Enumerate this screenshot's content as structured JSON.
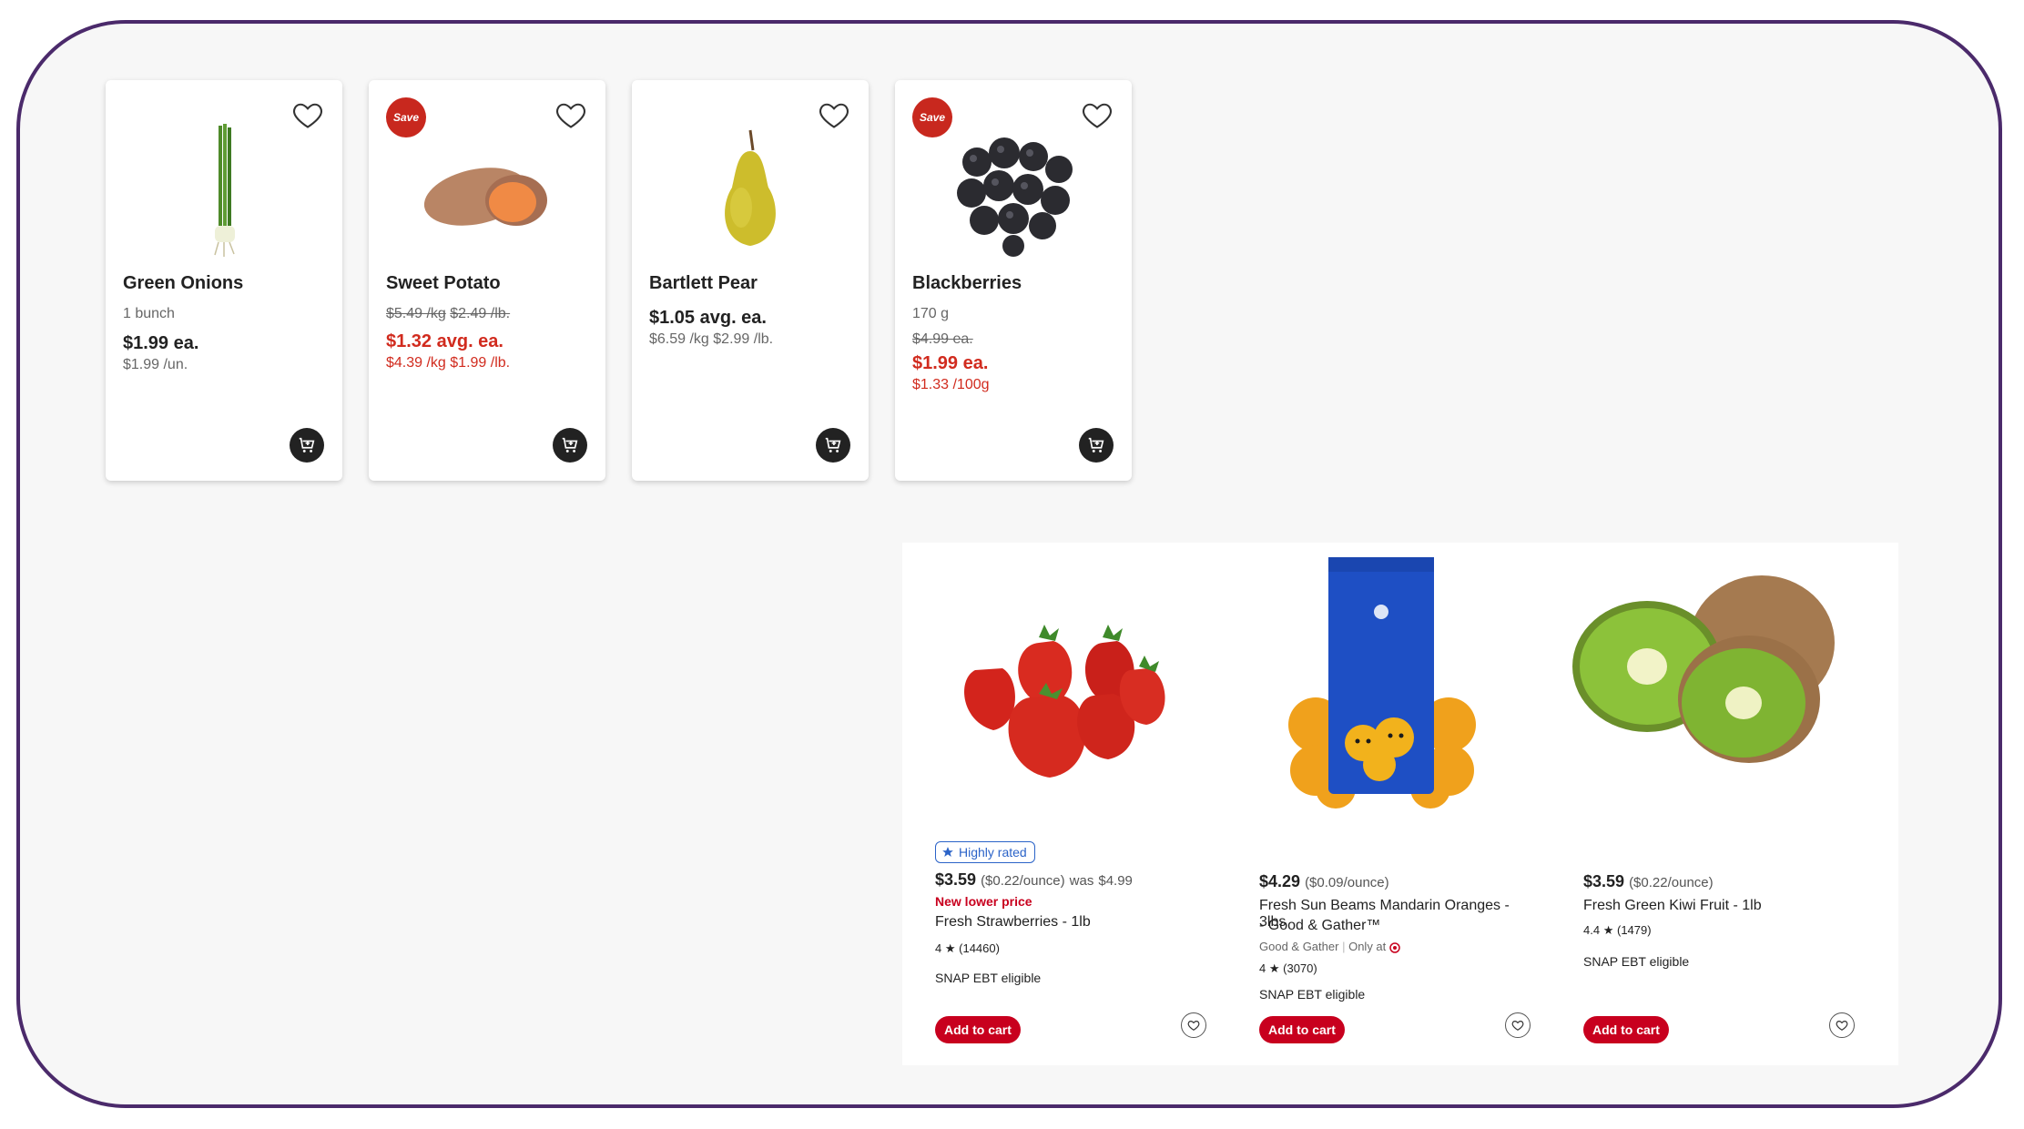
{
  "grocery_cards": [
    {
      "name": "Green Onions",
      "size": "1 bunch",
      "price": "$1.99 ea.",
      "unit_price": "$1.99 /un.",
      "image": "green-onions",
      "save": false
    },
    {
      "name": "Sweet Potato",
      "was_a": "$5.49 /kg",
      "was_b": "$2.49 /lb.",
      "price": "$1.32 avg. ea.",
      "unit_price": "$4.39 /kg $1.99 /lb.",
      "image": "sweet-potato",
      "save": true
    },
    {
      "name": "Bartlett Pear",
      "price": "$1.05 avg. ea.",
      "unit_price": "$6.59 /kg $2.99 /lb.",
      "image": "pear",
      "save": false
    },
    {
      "name": "Blackberries",
      "size": "170 g",
      "was": "$4.99 ea.",
      "price": "$1.99 ea.",
      "unit_price": "$1.33 /100g",
      "image": "blackberries",
      "save": true
    }
  ],
  "save_badge": "Save",
  "products": [
    {
      "title": "Fresh Strawberries - 1lb",
      "badge": "Highly rated",
      "price": "$3.59",
      "unit": "($0.22/ounce)",
      "was_label": "was",
      "was": "$4.99",
      "promo": "New lower price",
      "rating": "4",
      "reviews": "(14460)",
      "snap": "SNAP EBT eligible",
      "add": "Add to cart"
    },
    {
      "title_line1": "Fresh Sun Beams Mandarin Oranges - 3lbs",
      "title_line2": "- Good & Gather™",
      "price": "$4.29",
      "unit": "($0.09/ounce)",
      "brand": "Good & Gather",
      "only_at": "Only at",
      "rating": "4",
      "reviews": "(3070)",
      "snap": "SNAP EBT eligible",
      "add": "Add to cart"
    },
    {
      "title": "Fresh Green Kiwi Fruit - 1lb",
      "price": "$3.59",
      "unit": "($0.22/ounce)",
      "rating": "4.4",
      "reviews": "(1479)",
      "snap": "SNAP EBT eligible",
      "add": "Add to cart"
    }
  ],
  "colors": {
    "accent_red": "#c8001e",
    "frame": "#4b2a6b",
    "badge_blue": "#2b63c8"
  }
}
